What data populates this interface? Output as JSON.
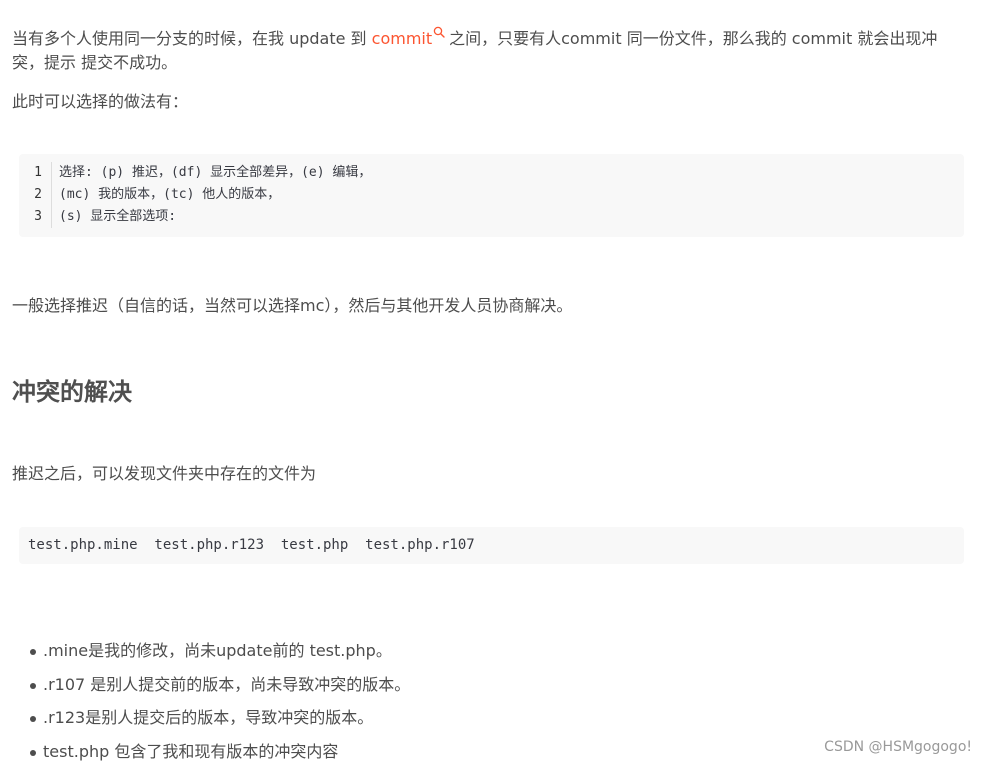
{
  "paragraphs": {
    "intro_before_link": "当有多个人使用同一分支的时候，在我 update 到 ",
    "intro_link": "commit",
    "intro_after_link": "之间，只要有人commit 同一份文件，那么我的 commit 就会出现冲突，提示  提交不成功。",
    "options_intro": "此时可以选择的做法有：",
    "postpone_advice": "一般选择推迟（自信的话，当然可以选择mc），然后与其他开发人员协商解决。",
    "after_postpone": "推迟之后，可以发现文件夹中存在的文件为"
  },
  "code_block_1": {
    "line_numbers": [
      "1",
      "2",
      "3"
    ],
    "lines": [
      "选择: (p) 推迟，(df) 显示全部差异，(e) 编辑，",
      "(mc) 我的版本，(tc) 他人的版本，",
      "(s) 显示全部选项:"
    ]
  },
  "heading": "冲突的解决",
  "code_block_2": {
    "line": "test.php.mine  test.php.r123  test.php  test.php.r107"
  },
  "list_items": [
    ".mine是我的修改，尚未update前的 test.php。",
    ".r107 是别人提交前的版本，尚未导致冲突的版本。",
    ".r123是别人提交后的版本，导致冲突的版本。",
    "test.php 包含了我和现有版本的冲突内容"
  ],
  "watermark": "CSDN @HSMgogogo!",
  "colors": {
    "text": "#4d4d4d",
    "link": "#fc5531",
    "code_bg": "#f8f8f8",
    "watermark": "#999999"
  }
}
